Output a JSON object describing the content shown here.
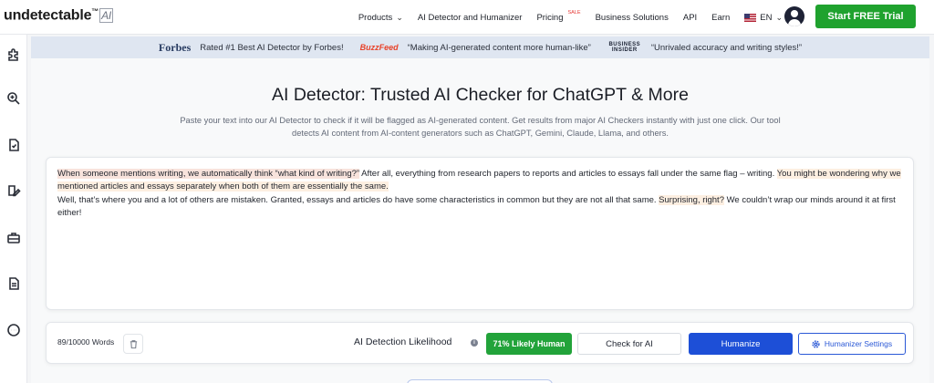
{
  "header": {
    "logo_text": "undetectable",
    "logo_tm": "™",
    "logo_ai": "AI",
    "nav": [
      {
        "label": "Products",
        "has_caret": true
      },
      {
        "label": "AI Detector and Humanizer"
      },
      {
        "label": "Pricing",
        "badge": "SALE"
      },
      {
        "label": "Business Solutions"
      },
      {
        "label": "API"
      },
      {
        "label": "Earn"
      }
    ],
    "language": "EN",
    "cta_label": "Start FREE Trial"
  },
  "sidebar": {
    "icons": [
      "puzzle-icon",
      "search-magnify-icon",
      "document-check-icon",
      "edit-document-icon",
      "briefcase-icon",
      "file-text-icon",
      "more-circle-icon"
    ]
  },
  "banner": {
    "items": [
      {
        "outlet": "Forbes",
        "quote": "Rated #1 Best AI Detector by Forbes!"
      },
      {
        "outlet": "BuzzFeed",
        "quote": "“Making AI-generated content more human-like”"
      },
      {
        "outlet": "BUSINESS INSIDER",
        "quote": "“Unrivaled accuracy and writing styles!”"
      }
    ]
  },
  "main": {
    "title": "AI Detector: Trusted AI Checker for ChatGPT & More",
    "subtitle_line1": "Paste your text into our AI Detector to check if it will be flagged as AI-generated content. Get results from major AI Checkers instantly with just one click. Our tool",
    "subtitle_line2": "detects AI content from AI-content generators such as ChatGPT, Gemini, Claude, Llama, and others.",
    "editor": {
      "seg1_hl": "When someone mentions writing, we automatically think “what kind of writing?”",
      "seg2": " After all, everything from research papers to reports and articles to essays fall under the same flag – writing. ",
      "seg3_hl": "You might be wondering why we mentioned articles and essays separately when both of them are essentially the same.",
      "seg4": " Well, that’s where you and a lot of others are mistaken. Granted, essays and articles do have some characteristics in common but they are not all that same. ",
      "seg5_hl": "Surprising, right?",
      "seg6": " We couldn’t wrap our minds around it at first either!"
    }
  },
  "toolbar": {
    "word_count": "89/10000 Words",
    "likelihood_label": "AI Detection Likelihood",
    "score_label": "71% Likely Human",
    "check_label": "Check for AI",
    "humanize_label": "Humanize",
    "settings_label": "Humanizer Settings"
  },
  "colors": {
    "cta_green": "#1fa22e",
    "score_green": "#22a33a",
    "humanize_blue": "#1d4fd7",
    "highlight": "#f8e3dc"
  }
}
